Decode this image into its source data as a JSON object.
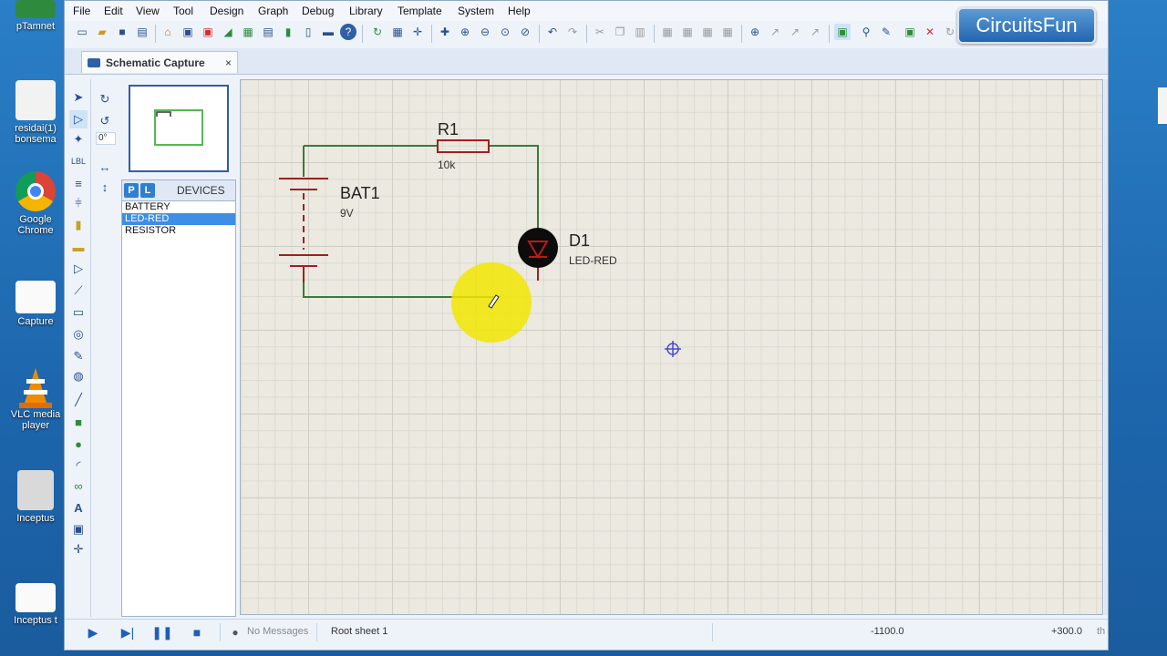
{
  "brand": "CircuitsFun",
  "desktop": {
    "icons": [
      {
        "name": "desktop-icon-1",
        "label": "pTamnet"
      },
      {
        "name": "desktop-icon-2",
        "label": "residai(1) bonsema"
      },
      {
        "name": "desktop-icon-chrome",
        "label": "Google Chrome"
      },
      {
        "name": "desktop-icon-capture",
        "label": "Capture"
      },
      {
        "name": "desktop-icon-vlc",
        "label": "VLC media player"
      },
      {
        "name": "desktop-icon-inceptus",
        "label": "Inceptus"
      },
      {
        "name": "desktop-icon-doc",
        "label": "Inceptus t"
      }
    ]
  },
  "menu": [
    "File",
    "Edit",
    "View",
    "Tool",
    "Design",
    "Graph",
    "Debug",
    "Library",
    "Template",
    "System",
    "Help"
  ],
  "tab": {
    "label": "Schematic Capture",
    "close": "×"
  },
  "rotation": {
    "angle": "0°"
  },
  "devices": {
    "title": "DEVICES",
    "p_label": "P",
    "l_label": "L",
    "items": [
      {
        "label": "BATTERY",
        "selected": false
      },
      {
        "label": "LED-RED",
        "selected": true
      },
      {
        "label": "RESISTOR",
        "selected": false
      }
    ]
  },
  "schematic": {
    "r1": {
      "ref": "R1",
      "value": "10k"
    },
    "bat1": {
      "ref": "BAT1",
      "value": "9V"
    },
    "d1": {
      "ref": "D1",
      "value": "LED-RED"
    },
    "wire_color": "#3a7a3a",
    "component_color": "#a02020",
    "highlight_color": "#f2e600"
  },
  "status": {
    "messages": "No Messages",
    "sheet": "Root sheet 1",
    "x": "-1100.0",
    "y": "+300.0",
    "unit": "th"
  }
}
